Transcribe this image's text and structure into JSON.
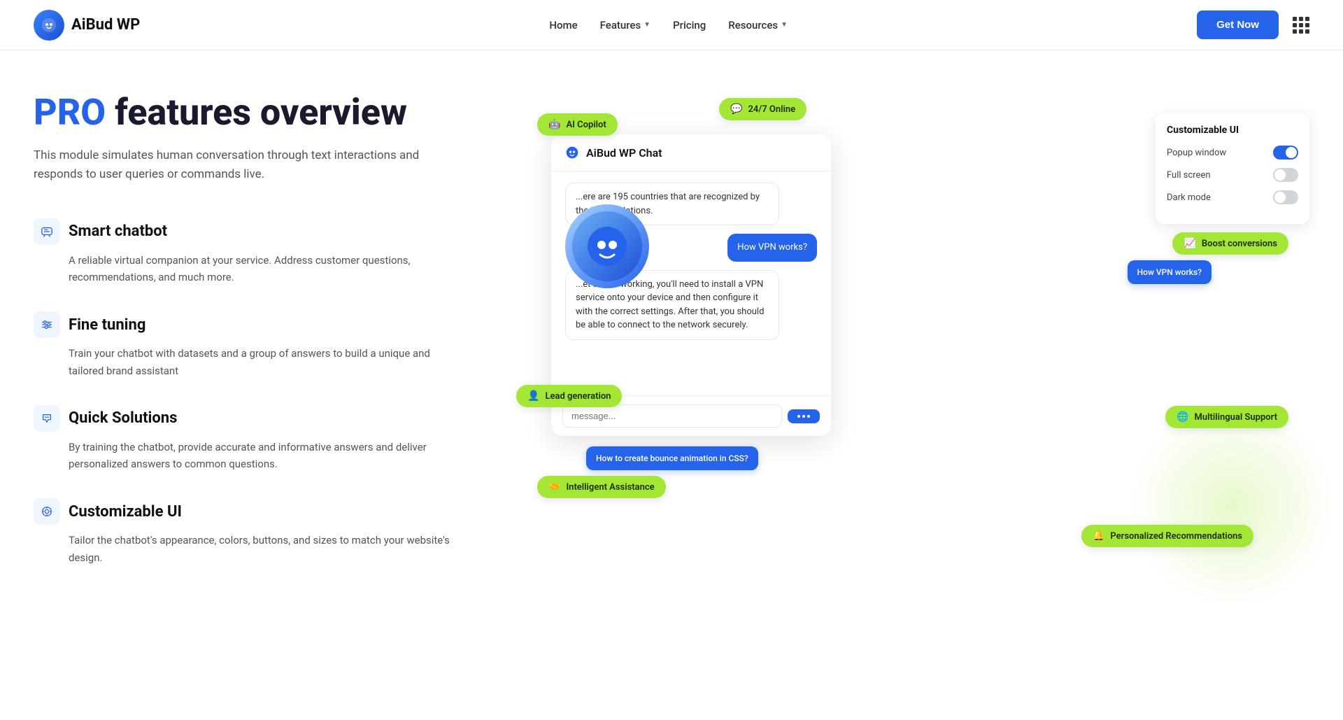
{
  "nav": {
    "logo_text": "AiBud WP",
    "links": [
      {
        "label": "Home",
        "has_dropdown": false
      },
      {
        "label": "Features",
        "has_dropdown": true
      },
      {
        "label": "Pricing",
        "has_dropdown": false
      },
      {
        "label": "Resources",
        "has_dropdown": true
      }
    ],
    "cta_label": "Get Now"
  },
  "hero": {
    "title_pro": "PRO",
    "title_rest": " features overview",
    "subtitle": "This module simulates human conversation through text interactions and responds to user queries or commands live."
  },
  "features": [
    {
      "id": "smart-chatbot",
      "title": "Smart chatbot",
      "desc": "A reliable virtual companion at your service. Address customer questions, recommendations, and much more.",
      "icon": "💬"
    },
    {
      "id": "fine-tuning",
      "title": "Fine tuning",
      "desc": "Train your chatbot with datasets and a group of answers to build a unique and tailored brand assistant",
      "icon": "⚙️"
    },
    {
      "id": "quick-solutions",
      "title": "Quick Solutions",
      "desc": "By training the chatbot, provide accurate and informative answers and deliver personalized answers to common questions.",
      "icon": "🔗"
    },
    {
      "id": "customizable-ui",
      "title": "Customizable UI",
      "desc": "Tailor the chatbot's appearance, colors, buttons, and sizes to match your website's design.",
      "icon": "🎨"
    }
  ],
  "chat": {
    "title": "AiBud WP Chat",
    "msg_bot_1": "...ere are 195 countries that are recognized by the United Nations.",
    "msg_user_1": "How VPN works?",
    "msg_bot_2": "...et a VPN working, you'll need to install a VPN service onto your device and then configure it with the correct settings. After that, you should be able to connect to the network securely.",
    "input_placeholder": "message...",
    "q2_label": "How to create bounce animation in CSS?"
  },
  "custom_panel": {
    "title": "Customizable UI",
    "options": [
      {
        "label": "Popup window",
        "on": true
      },
      {
        "label": "Full screen",
        "on": false
      },
      {
        "label": "Dark mode",
        "on": false
      }
    ]
  },
  "pills": [
    {
      "id": "ai-copilot",
      "label": "AI Copilot",
      "color": "green",
      "icon": "🤖"
    },
    {
      "id": "24-7-online",
      "label": "24/7 Online",
      "color": "green",
      "icon": "💬"
    },
    {
      "id": "boost-conversions",
      "label": "Boost conversions",
      "color": "green",
      "icon": "📈"
    },
    {
      "id": "lead-generation",
      "label": "Lead generation",
      "color": "green",
      "icon": "👤"
    },
    {
      "id": "multilingual-support",
      "label": "Multilingual Support",
      "color": "green",
      "icon": "🌐"
    },
    {
      "id": "intelligent-assistance",
      "label": "Intelligent Assistance",
      "color": "green",
      "icon": "🤝"
    },
    {
      "id": "personalized-recommendations",
      "label": "Personalized Recommendations",
      "color": "green",
      "icon": "🔔"
    }
  ]
}
